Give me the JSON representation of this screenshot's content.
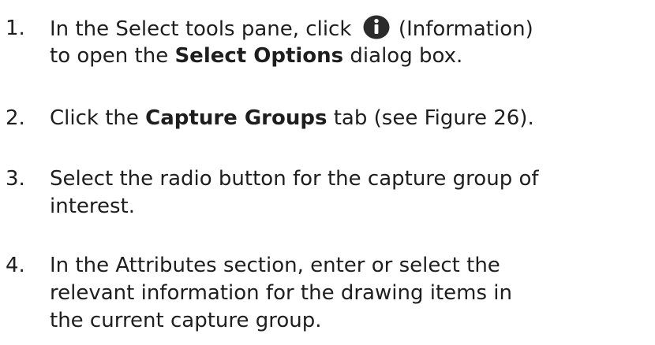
{
  "steps": [
    {
      "number": "1.",
      "lines": [
        {
          "before": "In the Select tools pane, click ",
          "icon": "information-icon",
          "after": " (Information)"
        },
        {
          "before": "to open the ",
          "bold": "Select Options",
          "after": " dialog box."
        }
      ]
    },
    {
      "number": "2.",
      "lines": [
        {
          "before": "Click the ",
          "bold": "Capture Groups",
          "after": " tab (see Figure 26)."
        }
      ]
    },
    {
      "number": "3.",
      "lines": [
        {
          "text": "Select the radio button for the capture group of"
        },
        {
          "text": "interest."
        }
      ]
    },
    {
      "number": "4.",
      "lines": [
        {
          "text": "In the Attributes section, enter or select the"
        },
        {
          "text": "relevant  information for the drawing items in"
        },
        {
          "text": "the current capture  group."
        }
      ]
    }
  ],
  "colors": {
    "text": "#1e1e1e",
    "icon_fill": "#2b2b2b",
    "icon_glyph": "#ffffff"
  }
}
